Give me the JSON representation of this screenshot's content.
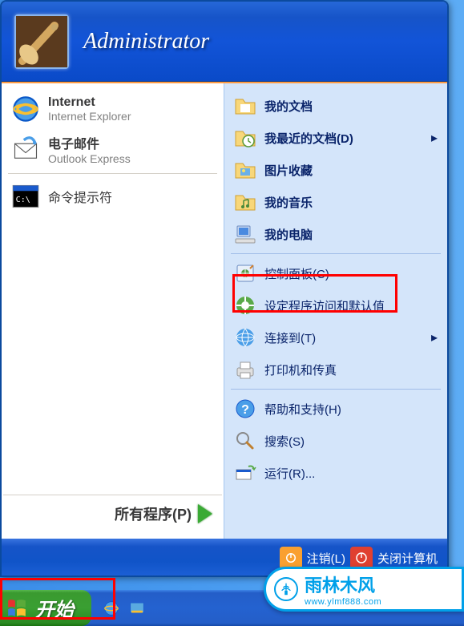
{
  "header": {
    "username": "Administrator"
  },
  "left": {
    "internet": {
      "title": "Internet",
      "subtitle": "Internet Explorer"
    },
    "email": {
      "title": "电子邮件",
      "subtitle": "Outlook Express"
    },
    "cmd": {
      "title": "命令提示符"
    },
    "all_programs": "所有程序(P)"
  },
  "right": {
    "my_docs": "我的文档",
    "recent_docs": "我最近的文档(D)",
    "pictures": "图片收藏",
    "music": "我的音乐",
    "computer": "我的电脑",
    "control_panel": "控制面板(C)",
    "default_programs": "设定程序访问和默认值",
    "connect": "连接到(T)",
    "printers": "打印机和传真",
    "help": "帮助和支持(H)",
    "search": "搜索(S)",
    "run": "运行(R)..."
  },
  "footer": {
    "logoff": "注销(L)",
    "shutdown": "关闭计算机"
  },
  "taskbar": {
    "start": "开始"
  },
  "watermark": {
    "brand": "雨林木风",
    "url": "www.ylmf888.com"
  }
}
